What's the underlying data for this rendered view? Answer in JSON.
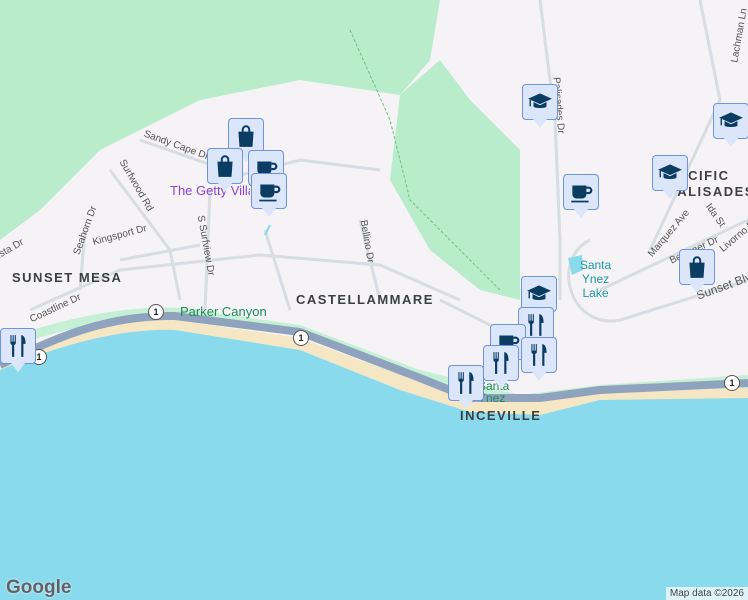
{
  "labels": {
    "areas": [
      "SUNSET MESA",
      "CASTELLAMMARE",
      "PACIFIC PALISADES",
      "INCEVILLE"
    ],
    "parker_canyon": "Parker Canyon",
    "getty": "The Getty Villa",
    "santa_ynez_lake": "Santa Ynez Lake",
    "santa_ynez_canyon": "Santa Ynez Canyon",
    "streets": {
      "sandy_cape": "Sandy Cape Dr",
      "surfwood": "Surfwood Rd",
      "seahorn": "Seahorn Dr",
      "kingsport": "Kingsport Dr",
      "s_surfview": "S Surfview Dr",
      "coastline": "Coastline Dr",
      "vista": "Vista Dr",
      "bellino": "Bellino Dr",
      "palisades": "Palisades Dr",
      "lachman": "Lachman Ln",
      "marquez": "Marquez Ave",
      "ida": "Ida St",
      "bellinger": "Bellinger Dr",
      "livorno": "Livorno Dr",
      "sunset": "Sunset Blvd"
    },
    "highway_shield": "1"
  },
  "markers": [
    {
      "type": "shopping",
      "icon": "shopping-bag-icon"
    },
    {
      "type": "shopping",
      "icon": "shopping-bag-icon"
    },
    {
      "type": "cafe",
      "icon": "coffee-cup-icon"
    },
    {
      "type": "cafe",
      "icon": "coffee-cup-icon"
    },
    {
      "type": "school",
      "icon": "graduation-cap-icon"
    },
    {
      "type": "school",
      "icon": "graduation-cap-icon"
    },
    {
      "type": "school",
      "icon": "graduation-cap-icon"
    },
    {
      "type": "school",
      "icon": "graduation-cap-icon"
    },
    {
      "type": "restaurant",
      "icon": "fork-knife-icon"
    },
    {
      "type": "cafe",
      "icon": "coffee-cup-icon"
    },
    {
      "type": "shopping",
      "icon": "shopping-bag-icon"
    },
    {
      "type": "restaurant",
      "icon": "fork-knife-icon"
    },
    {
      "type": "cafe",
      "icon": "coffee-cup-icon"
    },
    {
      "type": "restaurant",
      "icon": "fork-knife-icon"
    },
    {
      "type": "restaurant",
      "icon": "fork-knife-icon"
    },
    {
      "type": "restaurant",
      "icon": "fork-knife-icon"
    }
  ],
  "branding": {
    "logo": "Google",
    "attribution": "Map data ©2026"
  },
  "colors": {
    "land": "#f5f3f5",
    "park": "#b8ecca",
    "water": "#8adaee",
    "beach": "#f5e6c4",
    "highway": "#8fa3bf",
    "marker_bg": "#dbe6fb",
    "icon": "#0b3d62"
  }
}
